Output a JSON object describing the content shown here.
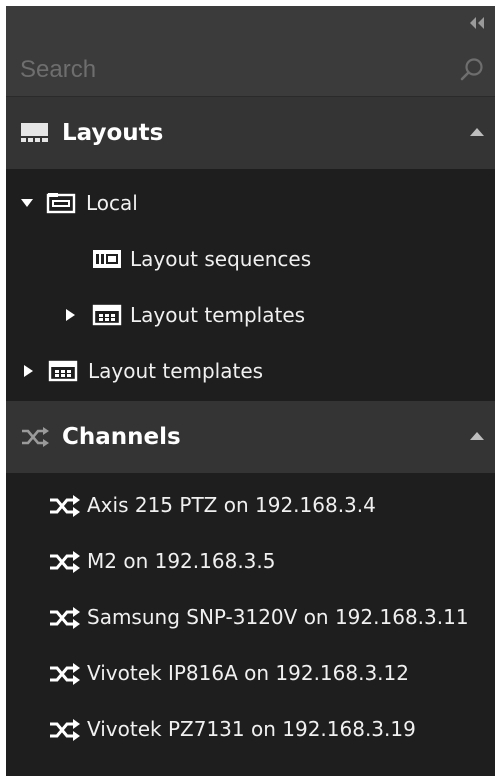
{
  "search": {
    "placeholder": "Search"
  },
  "sections": {
    "layouts": {
      "title": "Layouts",
      "tree": [
        {
          "label": "Local",
          "expanded": true
        },
        {
          "label": "Layout sequences"
        },
        {
          "label": "Layout templates",
          "expanded": false
        },
        {
          "label": "Layout templates",
          "expanded": false
        }
      ]
    },
    "channels": {
      "title": "Channels",
      "items": [
        "Axis 215 PTZ on 192.168.3.4",
        "M2 on 192.168.3.5",
        "Samsung SNP-3120V on 192.168.3.11",
        "Vivotek IP816A on 192.168.3.12",
        "Vivotek PZ7131 on 192.168.3.19"
      ]
    }
  },
  "icons": {
    "collapse": "double-chevron-left-icon",
    "search": "search-icon",
    "layouts": "layout-grid-icon",
    "channels": "shuffle-icon",
    "folder": "folder-icon",
    "sequence": "layout-sequence-icon",
    "template": "layout-template-icon"
  },
  "colors": {
    "panel_bg": "#1e1e1e",
    "header_bg": "#343434",
    "topbar_bg": "#3b3b3b",
    "text": "#f0f0f0",
    "placeholder": "#6e6e6e"
  }
}
